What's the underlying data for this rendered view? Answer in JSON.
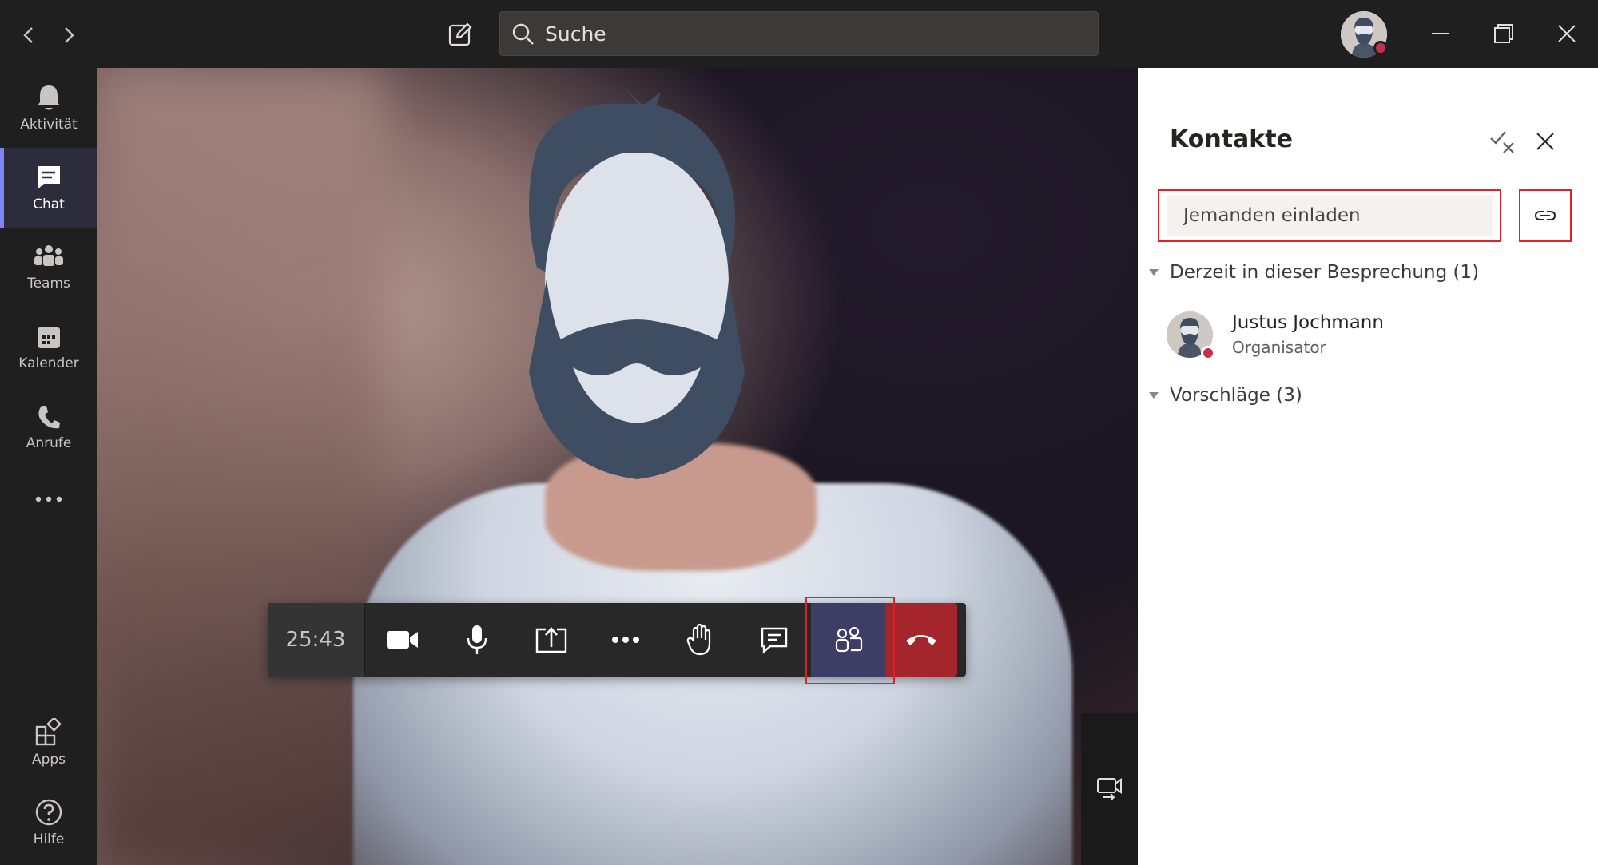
{
  "titlebar": {
    "search_placeholder": "Suche"
  },
  "rail": {
    "items": [
      {
        "label": "Aktivität",
        "icon": "bell-icon"
      },
      {
        "label": "Chat",
        "icon": "chat-icon",
        "active": true
      },
      {
        "label": "Teams",
        "icon": "teams-icon"
      },
      {
        "label": "Kalender",
        "icon": "calendar-icon"
      },
      {
        "label": "Anrufe",
        "icon": "phone-icon"
      },
      {
        "label": "Apps",
        "icon": "apps-icon"
      },
      {
        "label": "Hilfe",
        "icon": "help-icon"
      }
    ]
  },
  "call": {
    "timer": "25:43"
  },
  "panel": {
    "title": "Kontakte",
    "invite_placeholder": "Jemanden einladen",
    "current_section": "Derzeit in dieser Besprechung (1)",
    "suggest_section": "Vorschläge (3)",
    "participant": {
      "name": "Justus Jochmann",
      "role": "Organisator"
    }
  },
  "colors": {
    "accent": "#7f85f5",
    "hangup": "#a4262c",
    "status_busy": "#c4314b",
    "highlight": "#e0202a"
  }
}
